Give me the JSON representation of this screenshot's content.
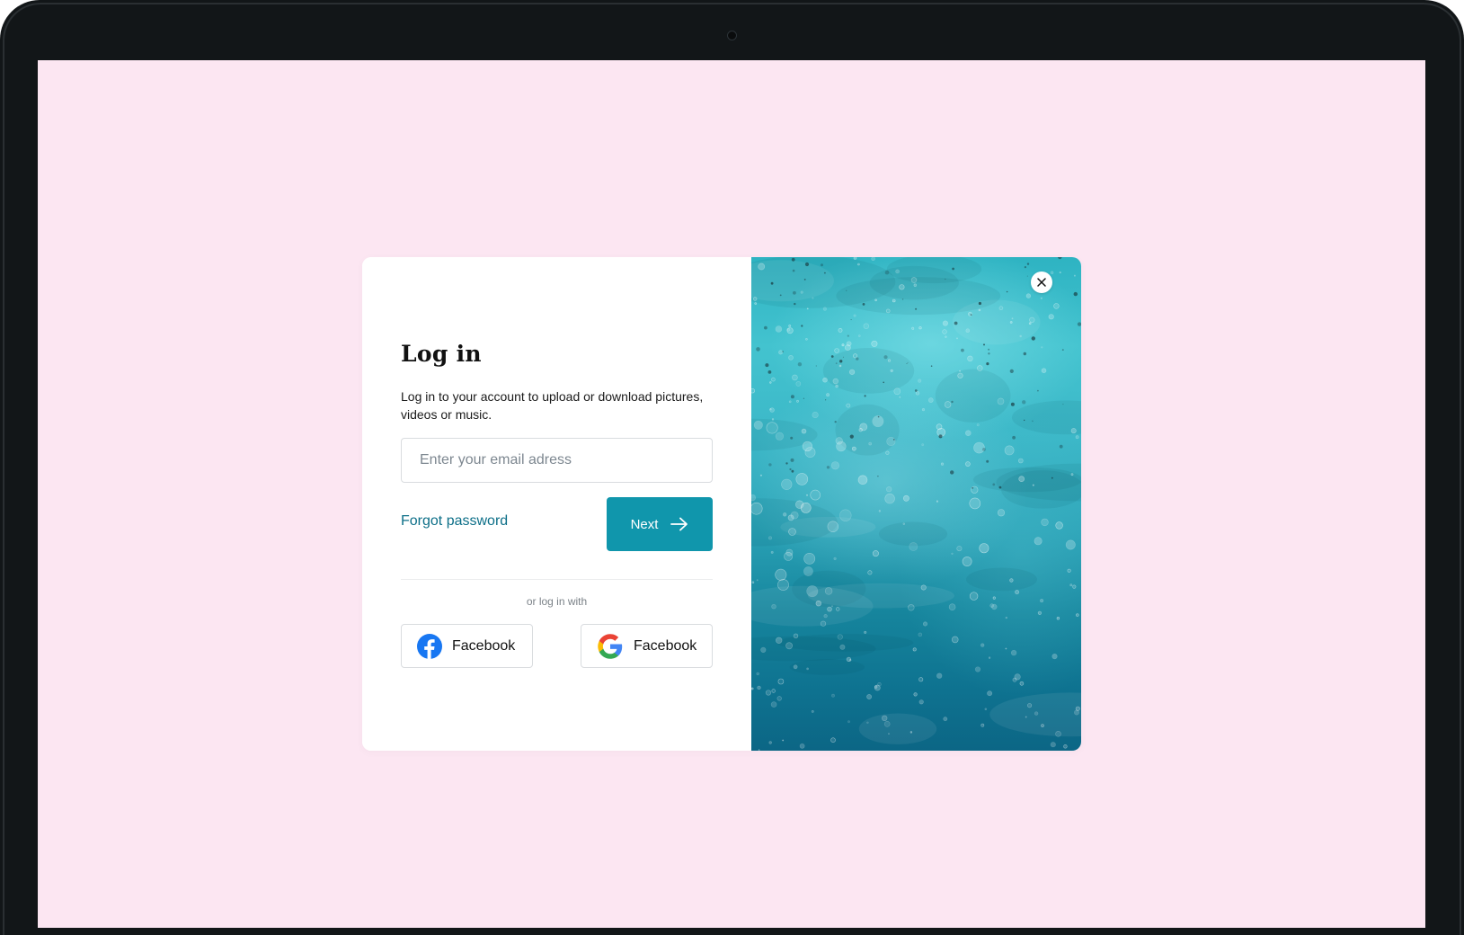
{
  "login": {
    "title": "Log in",
    "subtitle": "Log in to your account to upload or download pictures, videos or music.",
    "email_placeholder": "Enter your email adress",
    "forgot_password": "Forgot password",
    "next_label": "Next",
    "divider_text": "or log in with",
    "social": [
      {
        "label": "Facebook",
        "icon": "facebook-icon"
      },
      {
        "label": "Facebook",
        "icon": "google-icon"
      }
    ]
  },
  "colors": {
    "screen_background": "#fce6f2",
    "accent": "#1096ac",
    "link": "#0d6f88",
    "device_frame": "#121618"
  }
}
